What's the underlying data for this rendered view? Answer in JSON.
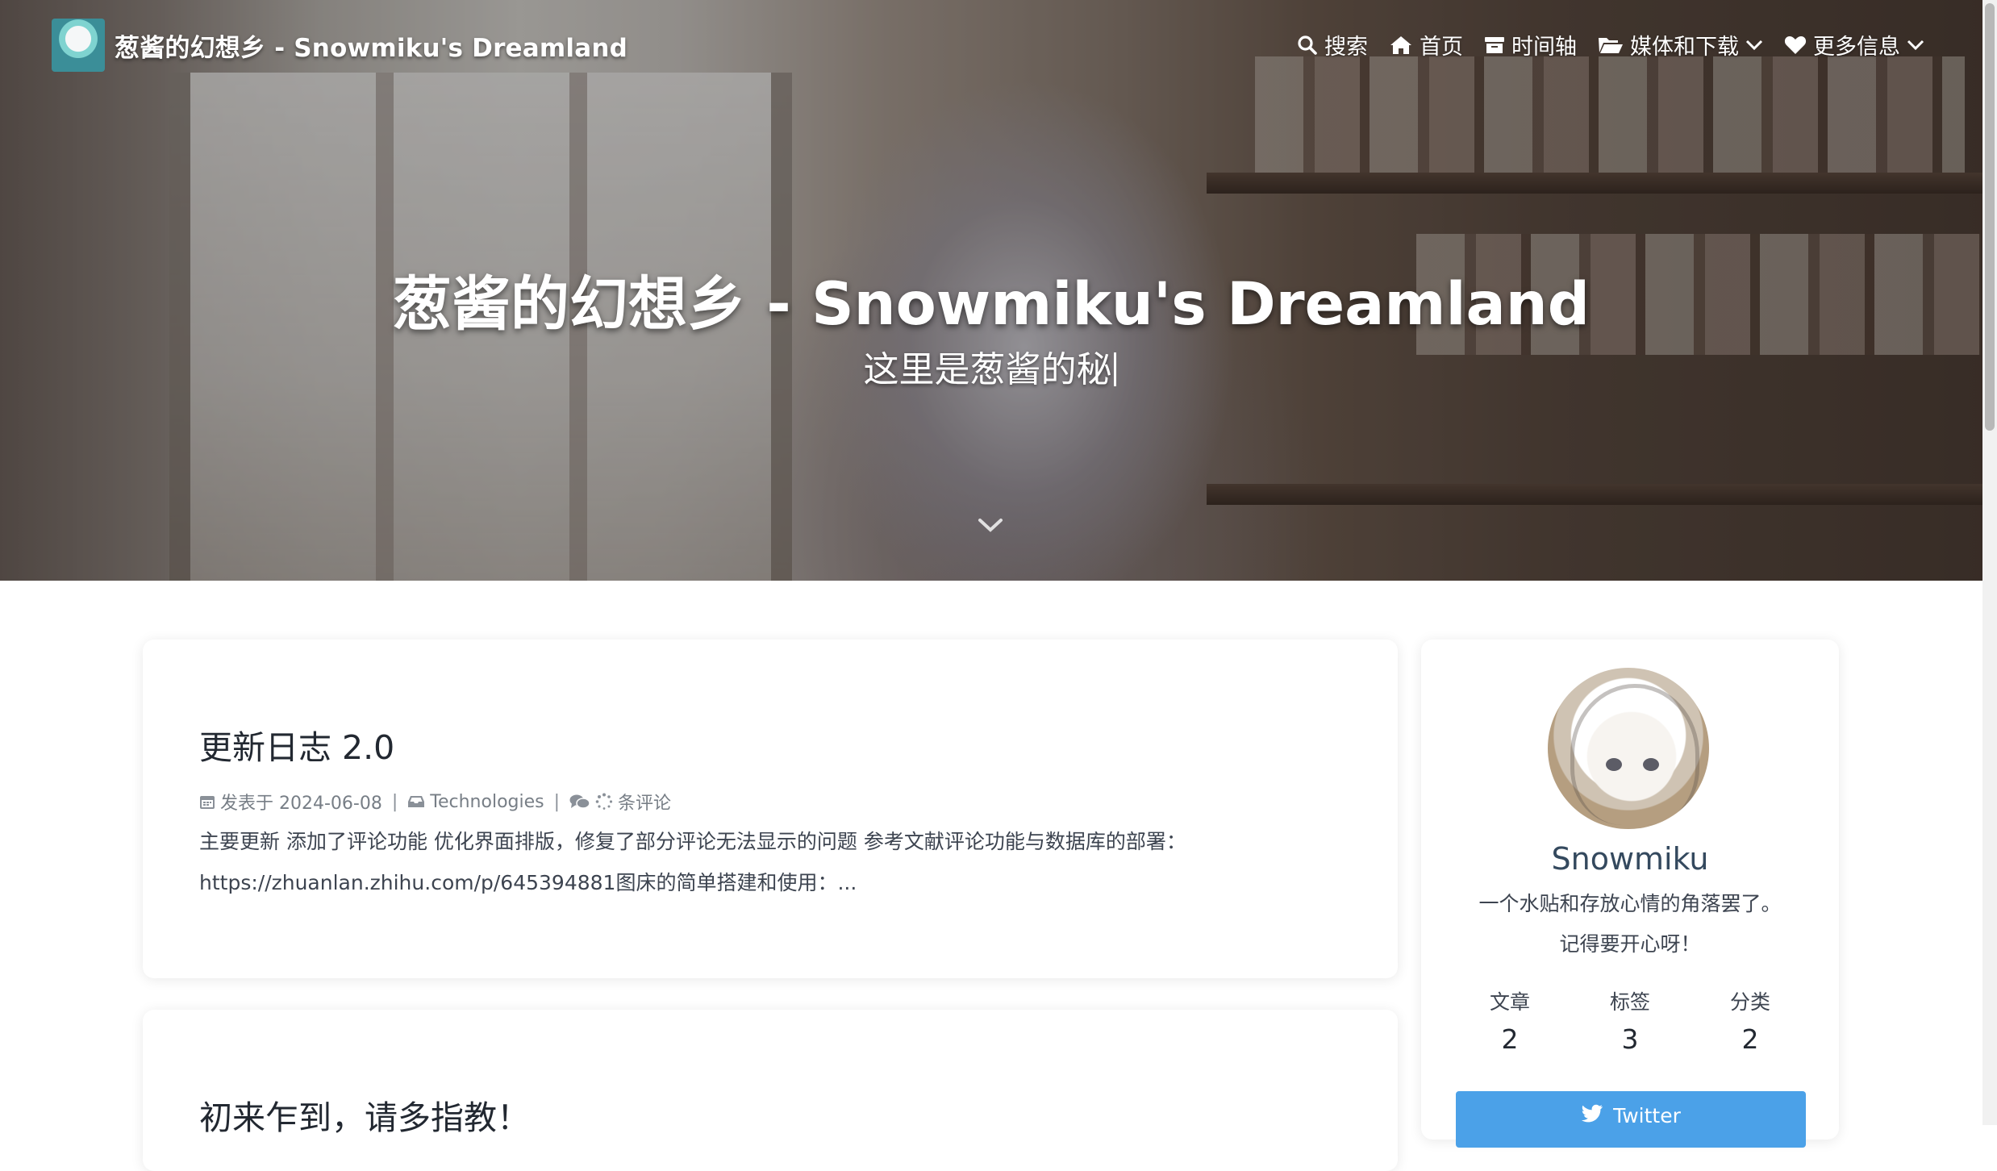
{
  "site": {
    "brand_title": "葱酱的幻想乡 - Snowmiku's Dreamland",
    "hero_title": "葱酱的幻想乡 - Snowmiku's Dreamland",
    "hero_subtitle": "这里是葱酱的秘"
  },
  "nav": {
    "items": [
      {
        "icon": "search-icon",
        "label": "搜索"
      },
      {
        "icon": "home-icon",
        "label": "首页"
      },
      {
        "icon": "archive-icon",
        "label": "时间轴"
      },
      {
        "icon": "folder-open-icon",
        "label": "媒体和下载",
        "dropdown": true
      },
      {
        "icon": "heart-icon",
        "label": "更多信息",
        "dropdown": true
      }
    ]
  },
  "posts": [
    {
      "title": "更新日志 2.0",
      "date_label": "发表于 2024-06-08",
      "category": "Technologies",
      "comments_label": "条评论",
      "excerpt": "主要更新 添加了评论功能 优化界面排版，修复了部分评论无法显示的问题 参考文献评论功能与数据库的部署：https://zhuanlan.zhihu.com/p/645394881图床的简单搭建和使用：..."
    },
    {
      "title": "初来乍到，请多指教！"
    }
  ],
  "sidebar": {
    "name": "Snowmiku",
    "description_line1": "一个水贴和存放心情的角落罢了。",
    "description_line2": "记得要开心呀！",
    "stats": [
      {
        "label": "文章",
        "value": "2"
      },
      {
        "label": "标签",
        "value": "3"
      },
      {
        "label": "分类",
        "value": "2"
      }
    ],
    "twitter_label": "Twitter"
  },
  "colors": {
    "twitter_blue": "#4ba1e8",
    "text_dark": "#222831",
    "meta_gray": "#777e86"
  }
}
